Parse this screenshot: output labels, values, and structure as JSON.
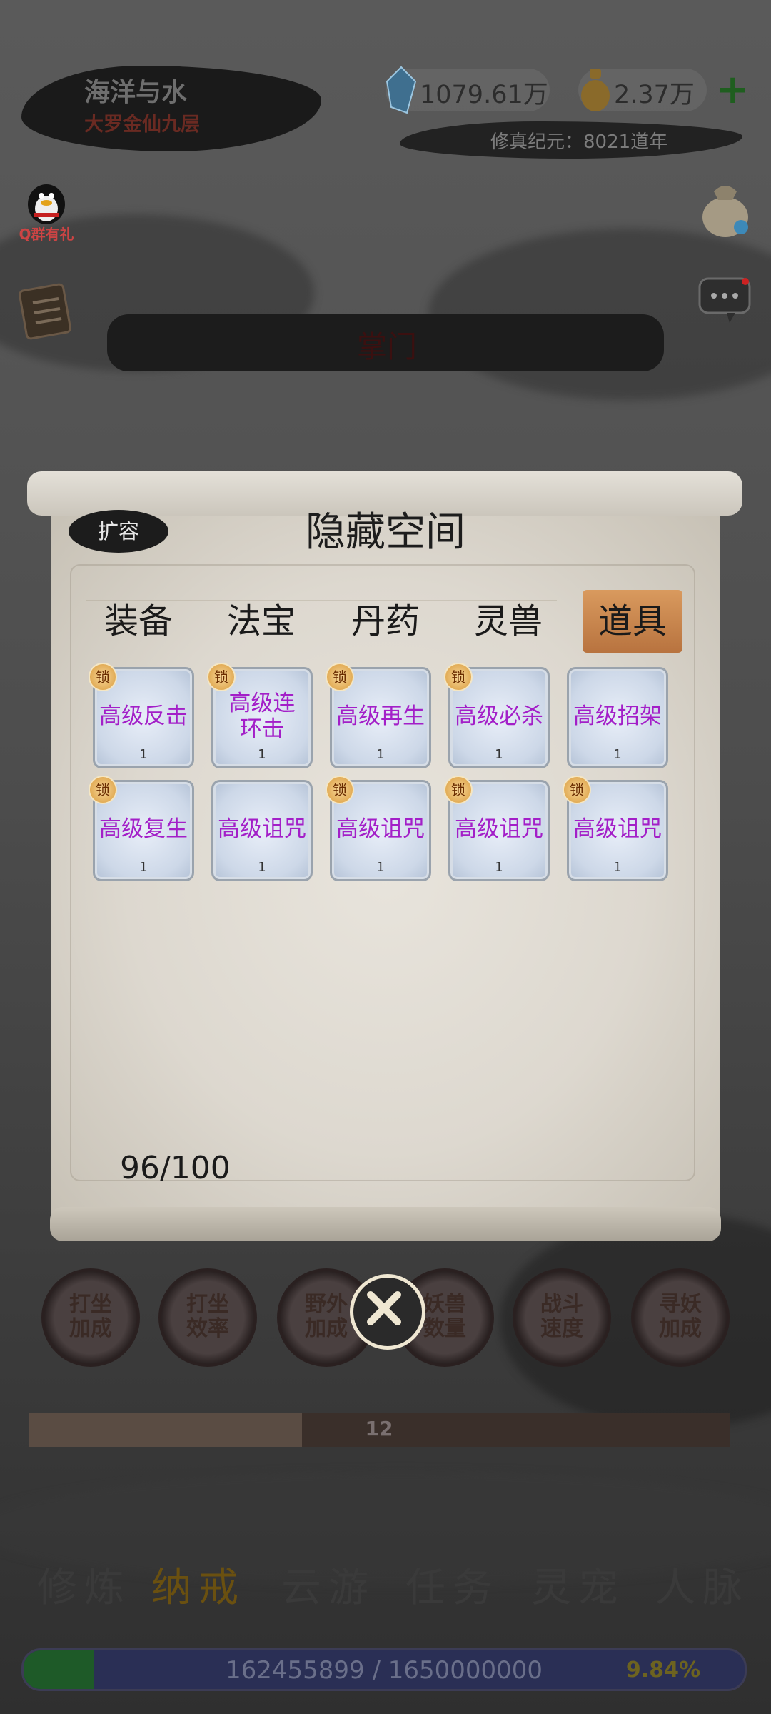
{
  "header": {
    "player_name": "海洋与水",
    "player_rank": "大罗金仙九层",
    "spirit_stones": "1079.61万",
    "gold": "2.37万",
    "add_label": "+",
    "era": "修真纪元：8021道年",
    "sect_title": "掌门"
  },
  "side": {
    "qq_group_label": "Q群有礼"
  },
  "modal": {
    "title": "隐藏空间",
    "expand_label": "扩容",
    "tabs": [
      "装备",
      "法宝",
      "丹药",
      "灵兽",
      "道具"
    ],
    "active_tab": 4,
    "lock_label": "锁",
    "items": [
      {
        "name": "高级反击",
        "qty": "1",
        "locked": true
      },
      {
        "name": "高级连环击",
        "qty": "1",
        "locked": true
      },
      {
        "name": "高级再生",
        "qty": "1",
        "locked": true
      },
      {
        "name": "高级必杀",
        "qty": "1",
        "locked": true
      },
      {
        "name": "高级招架",
        "qty": "1",
        "locked": false
      },
      {
        "name": "高级复生",
        "qty": "1",
        "locked": true
      },
      {
        "name": "高级诅咒",
        "qty": "1",
        "locked": false
      },
      {
        "name": "高级诅咒",
        "qty": "1",
        "locked": true
      },
      {
        "name": "高级诅咒",
        "qty": "1",
        "locked": true
      },
      {
        "name": "高级诅咒",
        "qty": "1",
        "locked": true
      }
    ],
    "capacity": "96/100"
  },
  "buffs": [
    {
      "line1": "打坐",
      "line2": "加成"
    },
    {
      "line1": "打坐",
      "line2": "效率"
    },
    {
      "line1": "野外",
      "line2": "加成"
    },
    {
      "line1": "妖兽",
      "line2": "数量"
    },
    {
      "line1": "战斗",
      "line2": "速度"
    },
    {
      "line1": "寻妖",
      "line2": "加成"
    }
  ],
  "level_bar": {
    "value": "12",
    "fill_fraction": 0.39
  },
  "nav": [
    "修炼",
    "纳戒",
    "云游",
    "任务",
    "灵宠",
    "人脉"
  ],
  "nav_active": 1,
  "exp": {
    "text": "162455899 / 1650000000",
    "percent": "9.84%",
    "fill_fraction": 0.0984
  },
  "colors": {
    "item_name": "#a31fc8",
    "active_tab": "#c9844a",
    "exp_fill": "#1e5a28"
  }
}
